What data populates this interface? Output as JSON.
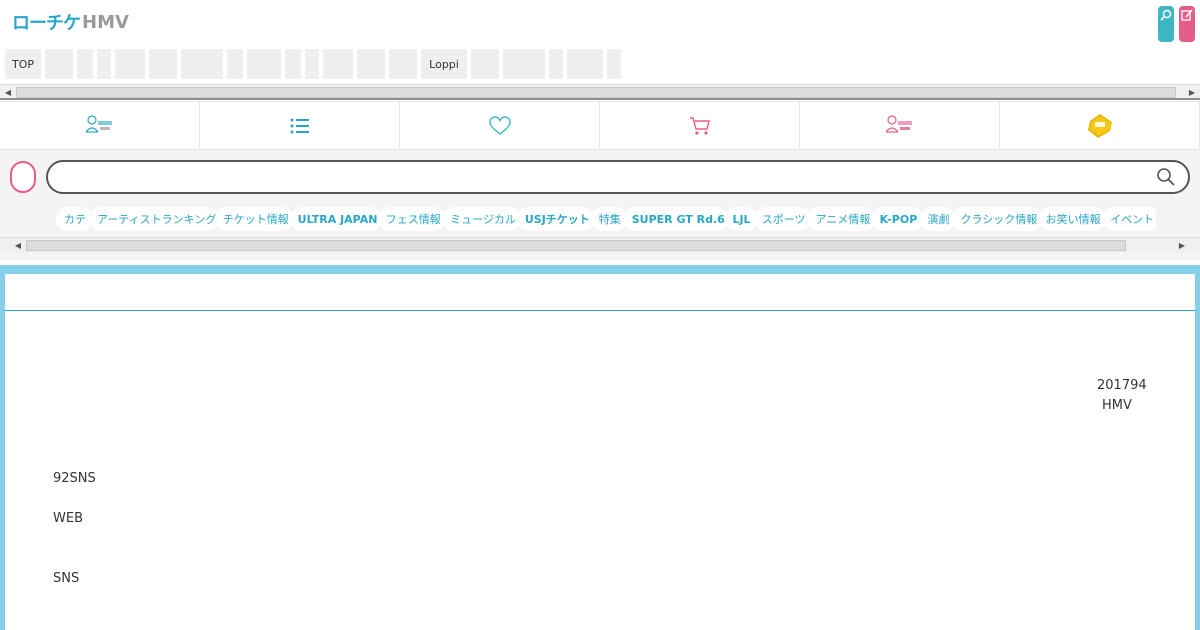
{
  "header": {
    "logo_main": "ローチケ",
    "logo_sub": "HMV",
    "search_icon": "search-icon",
    "edit_icon": "edit-icon",
    "colors": {
      "brand": "#2aa6c7",
      "accent_pink": "#e65c8a",
      "teal": "#3cb7c3"
    }
  },
  "category_nav": {
    "items": [
      {
        "label": "TOP",
        "w": 36
      },
      {
        "label": "",
        "w": 28
      },
      {
        "label": "",
        "w": 16
      },
      {
        "label": "",
        "w": 14
      },
      {
        "label": "",
        "w": 30
      },
      {
        "label": "",
        "w": 28
      },
      {
        "label": "",
        "w": 42
      },
      {
        "label": "",
        "w": 16
      },
      {
        "label": "",
        "w": 34
      },
      {
        "label": "",
        "w": 16
      },
      {
        "label": "",
        "w": 14
      },
      {
        "label": "",
        "w": 30
      },
      {
        "label": "",
        "w": 28
      },
      {
        "label": "",
        "w": 28
      },
      {
        "label": "Loppi",
        "w": 46
      },
      {
        "label": "",
        "w": 28
      },
      {
        "label": "",
        "w": 42
      },
      {
        "label": "",
        "w": 14
      },
      {
        "label": "",
        "w": 36
      },
      {
        "label": "",
        "w": 14
      }
    ]
  },
  "icon_bar": {
    "items": [
      {
        "icon": "lochike-hmv-user-icon"
      },
      {
        "icon": "list-icon"
      },
      {
        "icon": "heart-icon"
      },
      {
        "icon": "cart-icon"
      },
      {
        "icon": "lochike-hmv-member-icon"
      },
      {
        "icon": "ticket-tag-icon"
      }
    ]
  },
  "search": {
    "placeholder": "",
    "button_icon": "search-icon"
  },
  "tags": [
    {
      "label": "カテ",
      "bold": false
    },
    {
      "label": "アーティストランキング",
      "bold": false
    },
    {
      "label": "チケット情報",
      "bold": false
    },
    {
      "label": "ULTRA JAPAN",
      "bold": true
    },
    {
      "label": "フェス情報",
      "bold": false
    },
    {
      "label": "ミュージカル",
      "bold": false
    },
    {
      "label": "USJチケット",
      "bold": true
    },
    {
      "label": "特集",
      "bold": false
    },
    {
      "label": "SUPER GT Rd.6",
      "bold": true
    },
    {
      "label": "LJL",
      "bold": true
    },
    {
      "label": "スポーツ",
      "bold": false
    },
    {
      "label": "アニメ情報",
      "bold": false
    },
    {
      "label": "K-POP",
      "bold": true
    },
    {
      "label": "演劇",
      "bold": false
    },
    {
      "label": "クラシック情報",
      "bold": false
    },
    {
      "label": "お笑い情報",
      "bold": false
    },
    {
      "label": "イベント",
      "bold": false
    }
  ],
  "main": {
    "date_line": "201794",
    "brand_line": "HMV",
    "para1": "92SNS",
    "para2": "WEB",
    "para3": "SNS"
  }
}
